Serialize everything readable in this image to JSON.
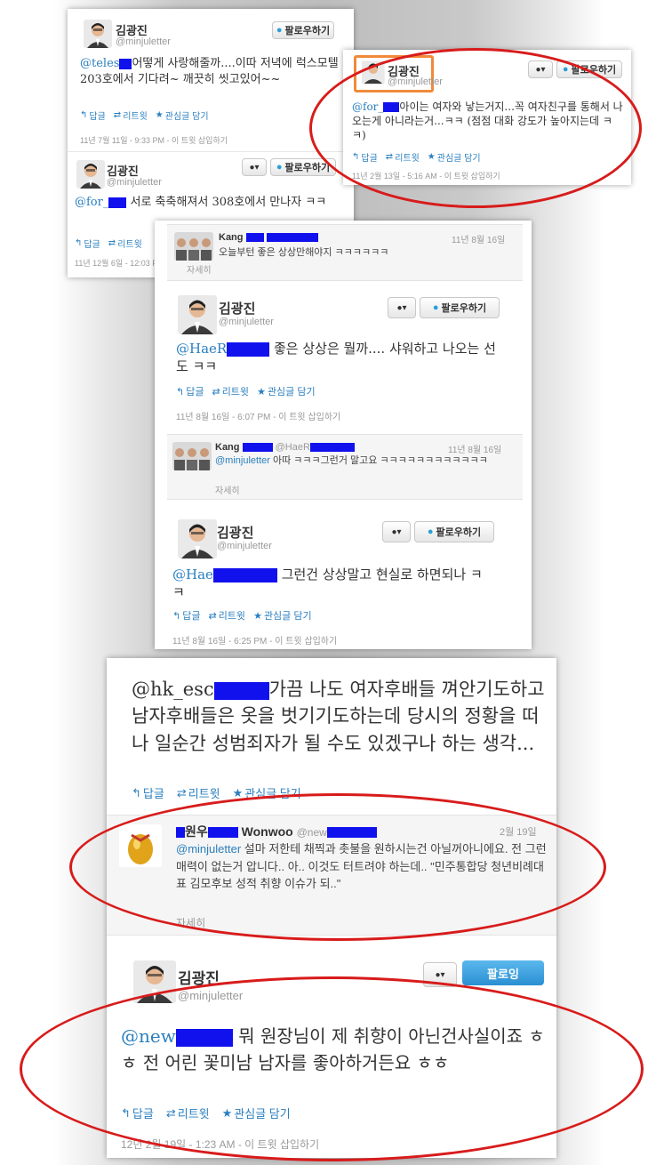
{
  "user": {
    "name": "김광진",
    "handle": "@minjuletter"
  },
  "buttons": {
    "follow": "팔로우하기",
    "following": "팔로잉",
    "user_menu": "▾"
  },
  "actions": {
    "reply": "답글",
    "retweet": "리트윗",
    "favorite": "관심글 담기"
  },
  "tweet1": {
    "mention": "@teles",
    "text": "어떻게 사랑해줄까....이따 저녁에 럭스모텔 203호에서 기다려~ 깨끗히 씻고있어~~",
    "meta": "11년 7월 11일 - 9:33 PM - 이 트윗 삽입하기"
  },
  "tweet2": {
    "mention": "@for_",
    "text": "서로 축축해져서 308호에서 만나자 ㅋㅋ",
    "meta": "11년 12월 6일 - 12:03 PM"
  },
  "tweet3": {
    "mention": "@for_",
    "text": "아이는 여자와 낳는거지...꼭 여자친구를 통해서 나오는게 아니라는거...ㅋㅋ (점점 대화 강도가 높아지는데 ㅋㅋ)",
    "meta": "11년 2월 13일 - 5:16 AM - 이 트윗 삽입하기"
  },
  "reply1": {
    "name": "Kang",
    "date": "11년 8월 16일",
    "text": "오늘부턴 좋은 상상만해야지 ㅋㅋㅋㅋㅋㅋ",
    "detail": "자세히"
  },
  "tweet4": {
    "mention": "@HaeR",
    "text": "좋은 상상은 뭘까.... 샤워하고 나오는 선도 ㅋㅋ",
    "meta": "11년 8월 16일 - 6:07 PM - 이 트윗 삽입하기"
  },
  "reply2": {
    "name": "Kang",
    "to": "@HaeR",
    "date": "11년 8월 16일",
    "mention": "@minjuletter",
    "text": "아따 ㅋㅋㅋ그런거 말고요 ㅋㅋㅋㅋㅋㅋㅋㅋㅋㅋㅋㅋ",
    "detail": "자세히"
  },
  "tweet5": {
    "mention": "@Hae",
    "text": "그런건 상상말고 현실로 하면되나 ㅋㅋ",
    "meta": "11년 8월 16일 - 6:25 PM - 이 트윗 삽입하기"
  },
  "tweet6": {
    "mention": "@hk_esc",
    "text": "가끔 나도 여자후배들 껴안기도하고 남자후배들은 옷을 벗기기도하는데 당시의 정황을 떠나 일순간 성범죄자가 될 수도 있겠구나 하는 생각..."
  },
  "reply3": {
    "name": "원우",
    "name2": "Wonwoo",
    "to": "@new",
    "date": "2월 19일",
    "mention": "@minjuletter",
    "text": "설마 저한테 채찍과 촛불을 원하시는건 아닐꺼아니에요. 전 그런 매력이 없는거 압니다.. 아.. 이것도 터트려야 하는데.. \"민주통합당 청년비례대표 김모후보 성적 취향 이슈가 되..\"",
    "detail": "자세히"
  },
  "tweet7": {
    "mention": "@new",
    "text": "뭐 원장님이 제 취향이 아닌건사실이죠 ㅎㅎ 전 어린 꽃미남 남자를 좋아하거든요 ㅎㅎ",
    "meta": "12년 2월 19일 - 1:23 AM - 이 트윗 삽입하기"
  },
  "colors": {
    "mention": "#2a7fbf",
    "redaction": "#1111ee",
    "annotation": "#d81b1b",
    "highlight": "#f08a3a"
  }
}
